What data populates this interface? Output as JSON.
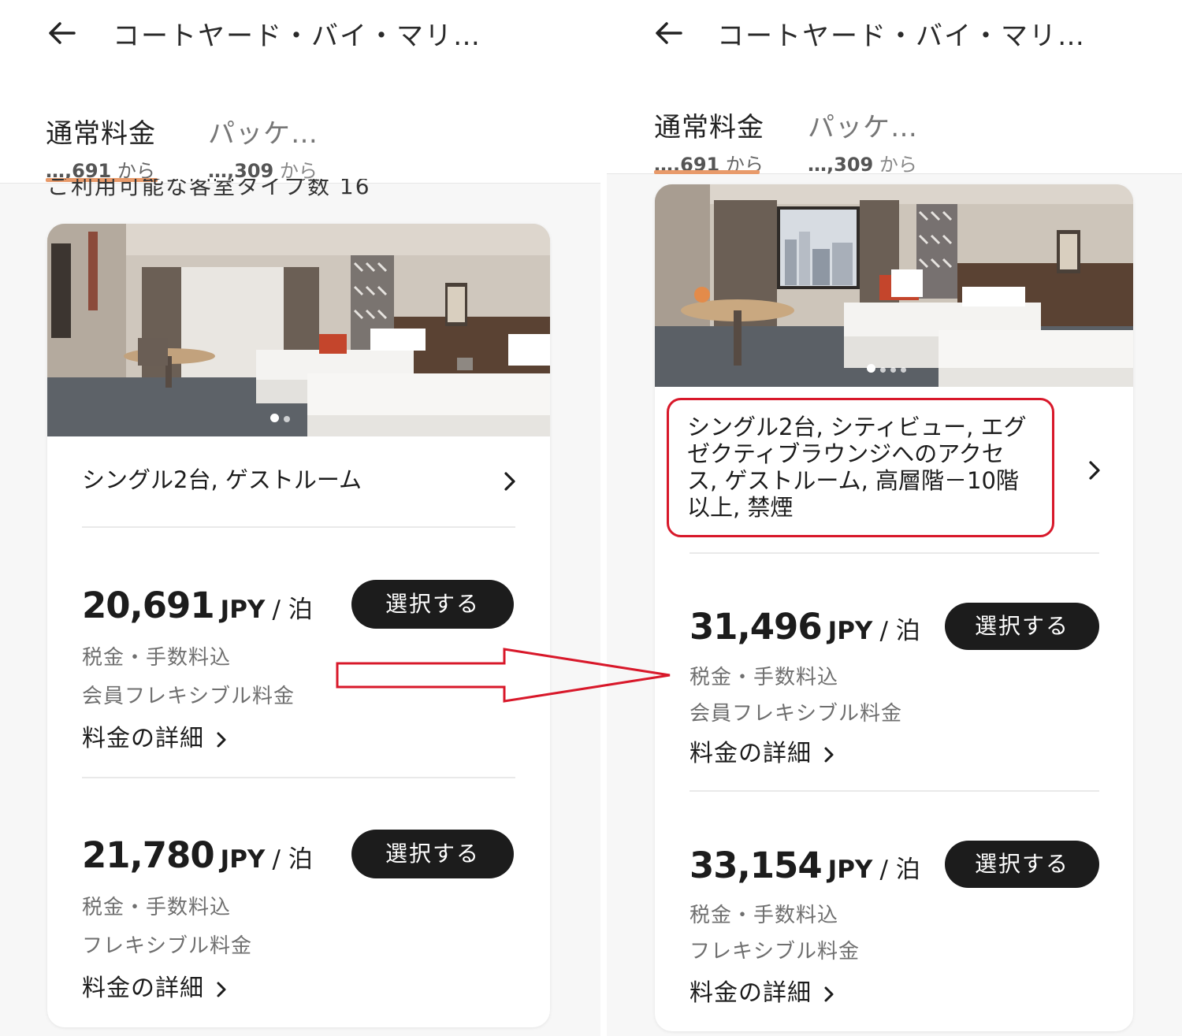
{
  "left": {
    "header": {
      "title": "コートヤード・バイ・マリ…",
      "back_icon": "arrow-left-icon"
    },
    "tabs": [
      {
        "label": "通常料金",
        "sub_value": "…,691",
        "sub_suffix": " から",
        "active": true
      },
      {
        "label": "パッケ…",
        "sub_value": "…,309",
        "sub_suffix": " から",
        "active": false
      }
    ],
    "cut_text": "ご利用可能な客室タイプ数 16",
    "room": {
      "name": "シングル2台, ゲストルーム",
      "image_dots": 2,
      "active_dot": 0
    },
    "rates": [
      {
        "amount": "20,691",
        "unit": "JPY",
        "per": "/ 泊",
        "tax_note": "税金・手数料込",
        "plan": "会員フレキシブル料金",
        "detail": "料金の詳細",
        "button": "選択する"
      },
      {
        "amount": "21,780",
        "unit": "JPY",
        "per": "/ 泊",
        "tax_note": "税金・手数料込",
        "plan": "フレキシブル料金",
        "detail": "料金の詳細",
        "button": "選択する"
      }
    ]
  },
  "right": {
    "header": {
      "title": "コートヤード・バイ・マリ…",
      "back_icon": "arrow-left-icon"
    },
    "tabs": [
      {
        "label": "通常料金",
        "sub_value": "…,691",
        "sub_suffix": " から",
        "active": true
      },
      {
        "label": "パッケ…",
        "sub_value": "…,309",
        "sub_suffix": " から",
        "active": false
      }
    ],
    "room": {
      "name_lines": [
        "シングル2台, シティビュー, エグ",
        "ゼクティブラウンジへのアクセ",
        "ス, ゲストルーム, 高層階－10階",
        "以上, 禁煙"
      ],
      "image_dots": 4,
      "active_dot": 0
    },
    "rates": [
      {
        "amount": "31,496",
        "unit": "JPY",
        "per": "/ 泊",
        "tax_note": "税金・手数料込",
        "plan": "会員フレキシブル料金",
        "detail": "料金の詳細",
        "button": "選択する"
      },
      {
        "amount": "33,154",
        "unit": "JPY",
        "per": "/ 泊",
        "tax_note": "税金・手数料込",
        "plan": "フレキシブル料金",
        "detail": "料金の詳細",
        "button": "選択する"
      }
    ]
  },
  "annotations": {
    "highlight_color": "#d8182a",
    "arrow_color": "#d8182a"
  },
  "colors": {
    "tab_underline": "#e89a6a",
    "button_bg": "#1c1c1c",
    "button_text": "#ffffff"
  }
}
